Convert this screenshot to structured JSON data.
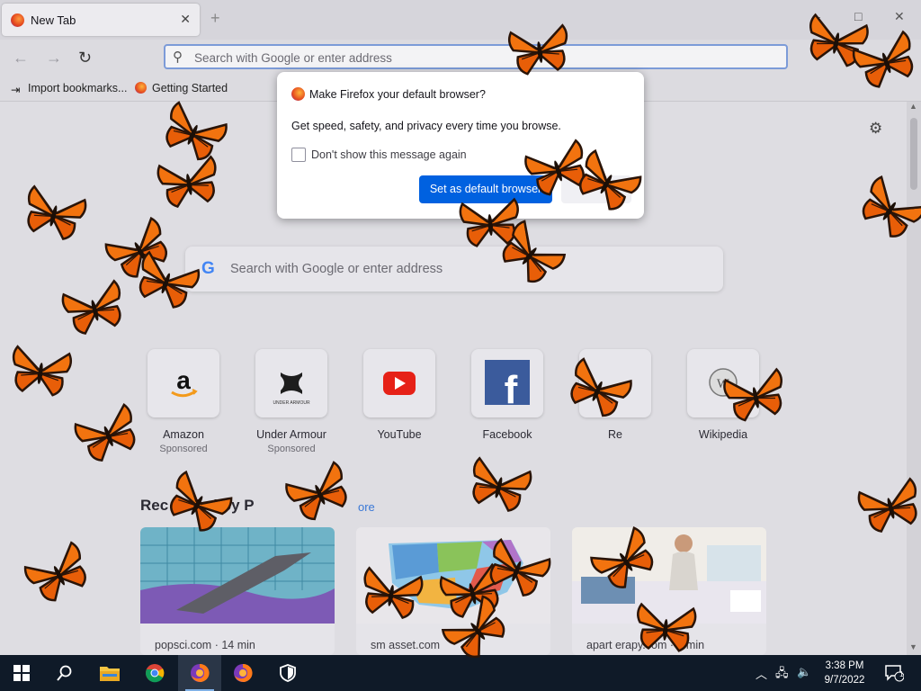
{
  "browser": {
    "tab_title": "New Tab",
    "tab_close": "✕",
    "new_tab": "+",
    "url_placeholder": "Search with Google or enter address",
    "bookmarks": [
      {
        "label": "Import bookmarks...",
        "icon": "import-icon"
      },
      {
        "label": "Getting Started",
        "icon": "firefox-icon"
      }
    ],
    "window_buttons": [
      "–",
      "□",
      "✕"
    ]
  },
  "newtab": {
    "search_placeholder": "Search with Google or enter address",
    "google_letter": "G",
    "top_sites": [
      {
        "name": "Amazon",
        "sponsored": "Sponsored"
      },
      {
        "name": "Under Armour",
        "sponsored": "Sponsored"
      },
      {
        "name": "YouTube",
        "sponsored": ""
      },
      {
        "name": "Facebook",
        "sponsored": ""
      },
      {
        "name": "Re",
        "sponsored": ""
      },
      {
        "name": "Wikipedia",
        "sponsored": ""
      }
    ],
    "recommended_title": "Rec    ended by P",
    "recommended_more": "ore",
    "cards": [
      {
        "source": "popsci.com · 14 min"
      },
      {
        "source": "sm     asset.com"
      },
      {
        "source": "apart         erapy.com · 5 min"
      }
    ]
  },
  "dialog": {
    "title": "Make Firefox your default browser?",
    "message": "Get speed, safety, and privacy every time you browse.",
    "checkbox_label": "Don't show this message again",
    "primary_button": "Set as default browser",
    "secondary_button": ""
  },
  "taskbar": {
    "time": "3:38 PM",
    "date": "9/7/2022",
    "notification_count": "1",
    "apps": [
      "start",
      "search",
      "file-explorer",
      "chrome",
      "firefox",
      "firefox",
      "security"
    ]
  },
  "colors": {
    "accent": "#0061e0",
    "butterfly_wing": "#f2730f",
    "taskbar": "#0f1a28"
  }
}
